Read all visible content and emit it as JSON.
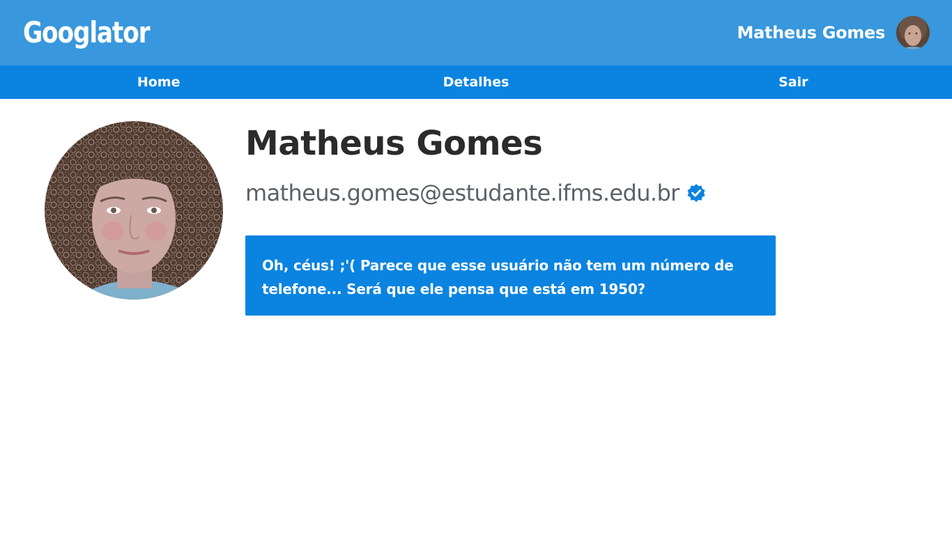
{
  "app": {
    "logo_text": "Googlator"
  },
  "header": {
    "user_name": "Matheus Gomes"
  },
  "nav": {
    "items": [
      {
        "label": "Home"
      },
      {
        "label": "Detalhes"
      },
      {
        "label": "Sair"
      }
    ]
  },
  "profile": {
    "name": "Matheus Gomes",
    "email": "matheus.gomes@estudante.ifms.edu.br",
    "verified_icon": "verified-badge-icon"
  },
  "alert": {
    "message": "Oh, céus! ;'( Parece que esse usuário não tem um número de telefone... Será que ele pensa que está em 1950?"
  },
  "colors": {
    "header_bg": "#3897dd",
    "nav_bg": "#0a84e0",
    "alert_bg": "#0a84e0",
    "verified": "#0a84e0"
  }
}
